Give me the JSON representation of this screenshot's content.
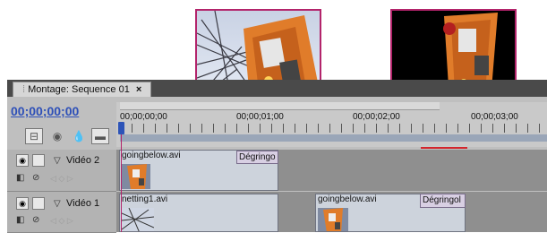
{
  "panel": {
    "tab_title": "Montage: Sequence 01",
    "tab_close": "×",
    "timecode": "00;00;00;00"
  },
  "ruler": {
    "labels": [
      "00;00;00;00",
      "00;00;01;00",
      "00;00;02;00",
      "00;00;03;00"
    ]
  },
  "tracks": [
    {
      "name": "Vidéo 2",
      "clips": [
        {
          "title": "goingbelow.avi",
          "transition": "Dégringo"
        }
      ]
    },
    {
      "name": "Vidéo 1",
      "clips": [
        {
          "title": "netting1.avi"
        },
        {
          "title": "goingbelow.avi",
          "transition": "Dégringol"
        }
      ]
    }
  ],
  "icons": {
    "grip": "⁞",
    "eye": "👁",
    "chevron": "▽",
    "keyframe_nav": "◁ ◇ ▷"
  },
  "colors": {
    "callout": "#b3246b",
    "timecode": "#2e50b8",
    "playhead": "#2d54b8",
    "render_bar": "#d3262d"
  }
}
